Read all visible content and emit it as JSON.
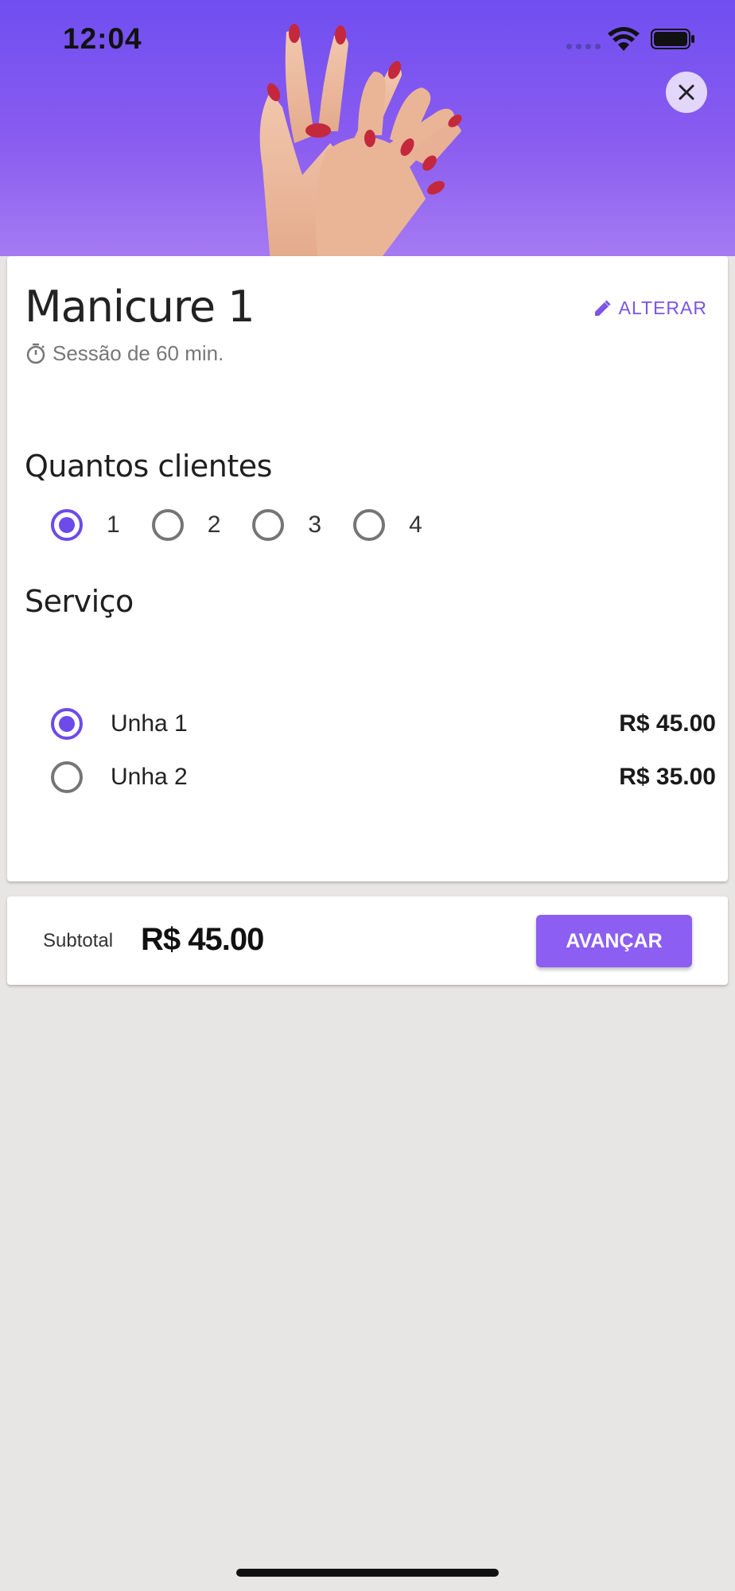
{
  "status_bar": {
    "time": "12:04"
  },
  "service": {
    "title": "Manicure 1",
    "session": "Sessão de 60 min.",
    "edit_label": "ALTERAR"
  },
  "clients": {
    "heading": "Quantos clientes",
    "options": [
      "1",
      "2",
      "3",
      "4"
    ],
    "selected": "1"
  },
  "services": {
    "heading": "Serviço",
    "items": [
      {
        "name": "Unha 1",
        "price": "R$ 45.00",
        "selected": true
      },
      {
        "name": "Unha 2",
        "price": "R$ 35.00",
        "selected": false
      }
    ]
  },
  "footer": {
    "subtotal_label": "Subtotal",
    "subtotal_value": "R$ 45.00",
    "next_label": "AVANÇAR"
  },
  "colors": {
    "accent": "#6d4aea",
    "button": "#8c5ef2",
    "header_top": "#6f4ef0",
    "header_bottom": "#a57af2",
    "background": "#e8e5e5"
  },
  "icons": {
    "close": "close-icon",
    "edit": "pencil-icon",
    "timer": "stopwatch-icon",
    "wifi": "wifi-icon",
    "battery": "battery-icon",
    "signal": "cellular-signal-icon"
  }
}
